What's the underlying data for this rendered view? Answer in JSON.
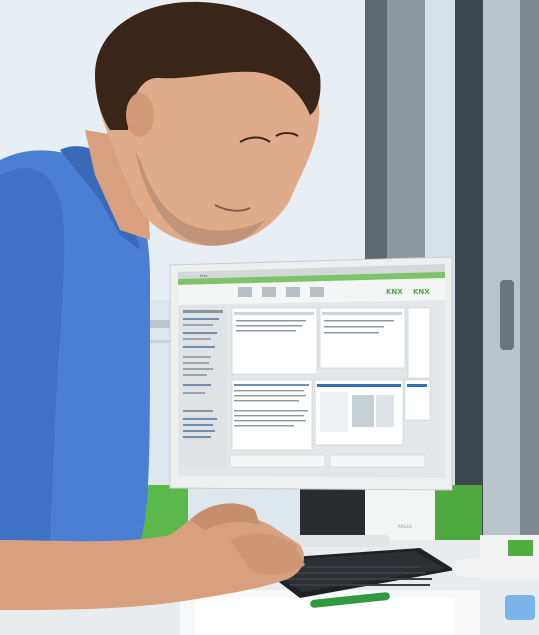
{
  "photo": {
    "subject": "man-at-desk",
    "monitor": {
      "window_title": "ETS5",
      "logo_text": "KNX",
      "logo_text_secondary": "KNX",
      "brand_label": "ARGUS"
    }
  },
  "colors": {
    "shirt": "#4a7fd4",
    "sky": "#dfe8ee",
    "window_frame": "#6e7a82",
    "green_accent": "#5bb84a",
    "monitor_bezel": "#f0f1f1"
  }
}
